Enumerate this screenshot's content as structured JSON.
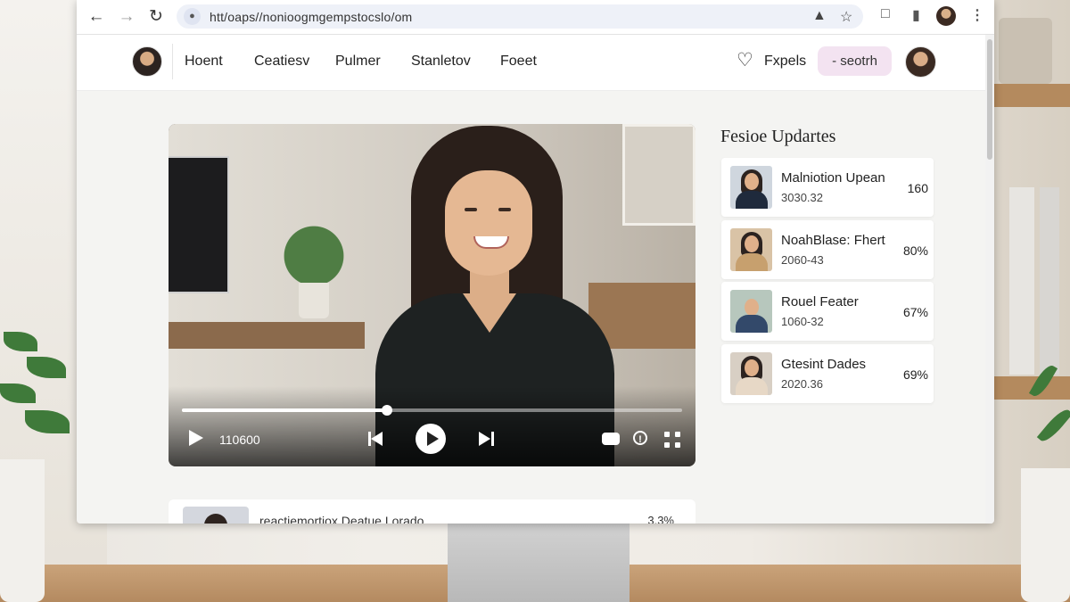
{
  "browser": {
    "url": "htt/oaps//nonioogmgempstocslo/om",
    "back_icon": "arrow-left-icon",
    "forward_icon": "arrow-right-icon",
    "reload_icon": "reload-icon"
  },
  "header": {
    "nav": [
      "Hoent",
      "Ceatiesv",
      "Pulmer",
      "Stanletov",
      "Foeet"
    ],
    "explore_label": "Fxpels",
    "search_label": "- seotrh"
  },
  "video": {
    "time": "110600",
    "progress_fraction": 0.41
  },
  "updates": {
    "title": "Fesioe Updartes",
    "items": [
      {
        "title": "Malniotion Upean",
        "sub": "3030.32",
        "stat": "160"
      },
      {
        "title": "NoahBlase: Fhert",
        "sub": "2060-43",
        "stat": "80%"
      },
      {
        "title": "Rouel Feater",
        "sub": "1060-32",
        "stat": "67%"
      },
      {
        "title": "Gtesint Dades",
        "sub": "2020.36",
        "stat": "69%"
      }
    ]
  },
  "below": {
    "text": "reactiemortiox  Deatue  Lorado",
    "stat": "3.3%"
  },
  "colors": {
    "search_pill": "#f3e3f1",
    "accent": "#222222"
  }
}
